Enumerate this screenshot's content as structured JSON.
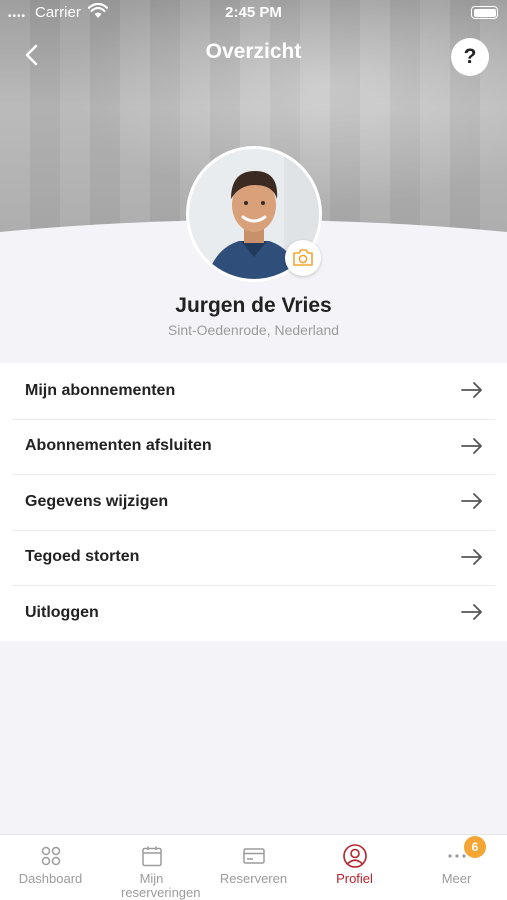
{
  "status_bar": {
    "carrier": "Carrier",
    "time": "2:45 PM",
    "signal": "••••"
  },
  "header": {
    "title": "Overzicht",
    "help_label": "?"
  },
  "profile": {
    "name": "Jurgen de Vries",
    "location": "Sint-Oedenrode, Nederland"
  },
  "menu": {
    "items": [
      {
        "label": "Mijn abonnementen"
      },
      {
        "label": "Abonnementen afsluiten"
      },
      {
        "label": "Gegevens wijzigen"
      },
      {
        "label": "Tegoed storten"
      },
      {
        "label": "Uitloggen"
      }
    ]
  },
  "tab_bar": {
    "tabs": [
      {
        "label": "Dashboard",
        "icon": "dashboard-icon"
      },
      {
        "label": "Mijn reserveringen",
        "icon": "calendar-icon"
      },
      {
        "label": "Reserveren",
        "icon": "card-icon"
      },
      {
        "label": "Profiel",
        "icon": "profile-icon"
      },
      {
        "label": "Meer",
        "icon": "more-icon"
      }
    ],
    "active": "Profiel",
    "badge": "6"
  },
  "colors": {
    "accent": "#b3232c",
    "camera": "#f4a533",
    "badge": "#f4a533"
  }
}
